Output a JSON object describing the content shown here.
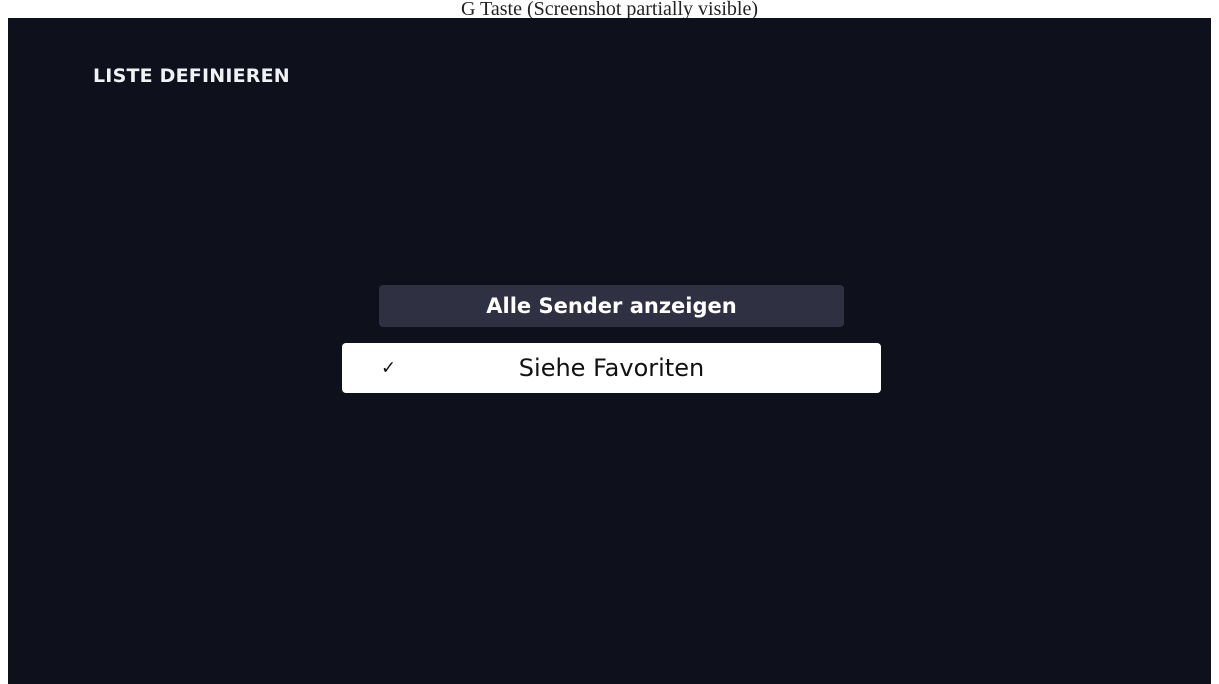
{
  "caption": {
    "text": "G Taste (Screenshot partially visible)"
  },
  "screen": {
    "title": "LISTE DEFINIEREN",
    "options": [
      {
        "label": "Alle Sender anzeigen",
        "selected": false
      },
      {
        "label": "Siehe Favoriten",
        "selected": true,
        "check_icon": "✓"
      }
    ]
  },
  "colors": {
    "background": "#0e101b",
    "option_unselected": "#2f3142",
    "option_selected": "#ffffff",
    "text_light": "#ffffff",
    "text_dark": "#111111"
  }
}
